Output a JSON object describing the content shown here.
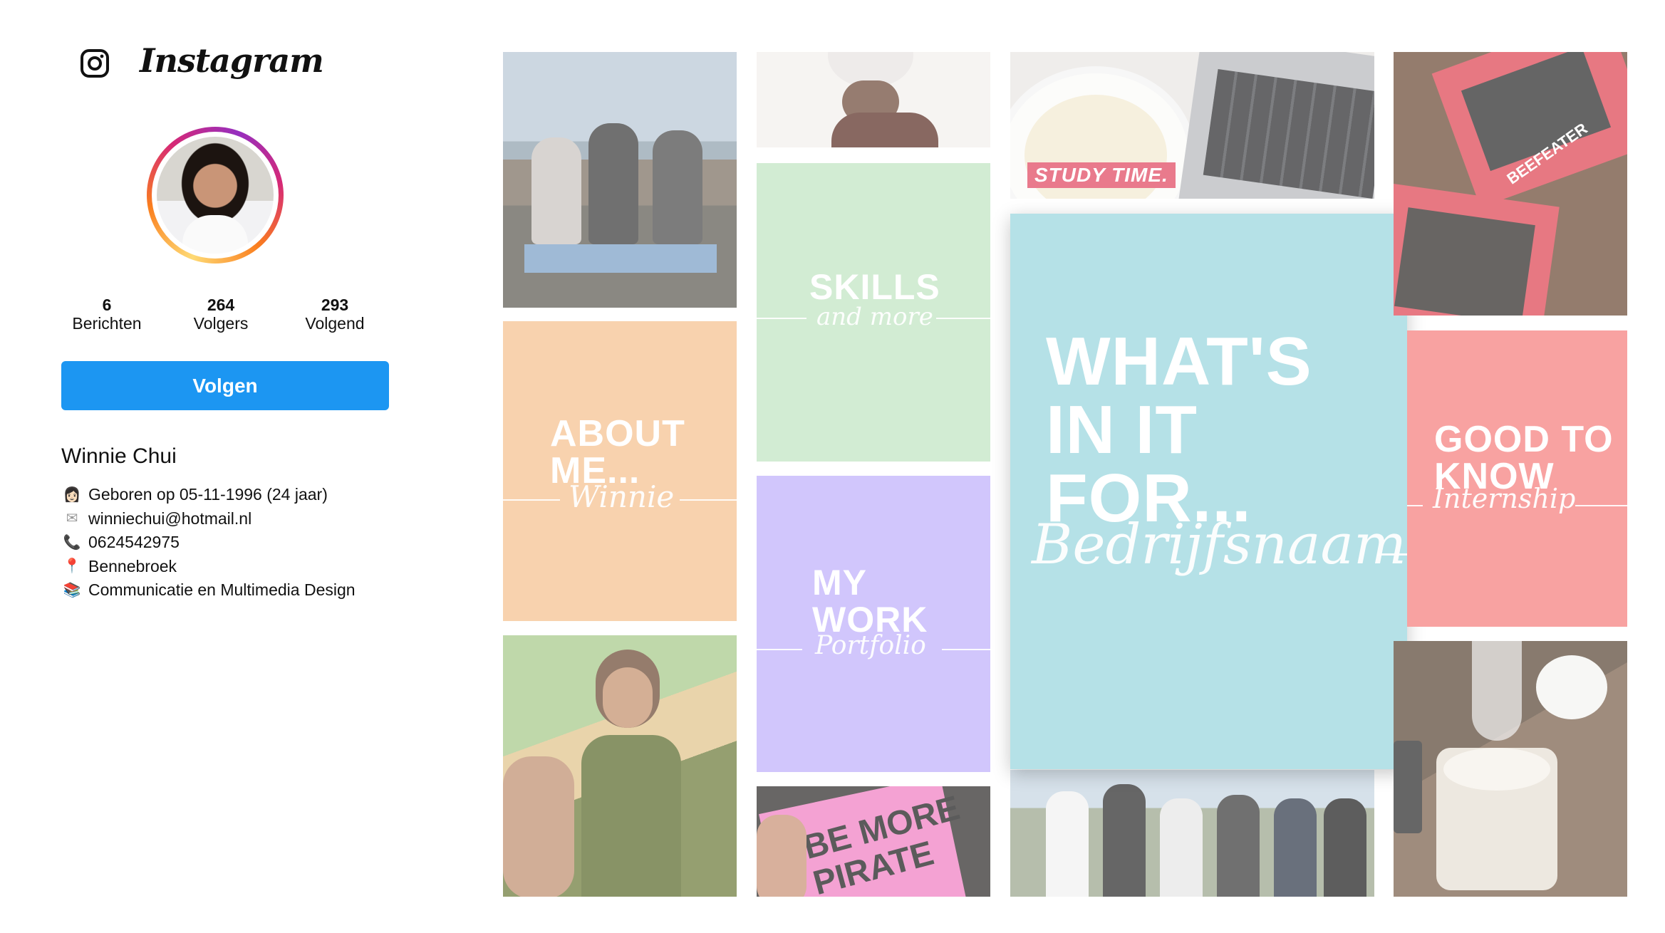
{
  "app": {
    "wordmark": "Instagram",
    "logo_icon": "instagram-camera-icon"
  },
  "profile": {
    "stats": [
      {
        "value": "6",
        "label": "Berichten"
      },
      {
        "value": "264",
        "label": "Volgers"
      },
      {
        "value": "293",
        "label": "Volgend"
      }
    ],
    "follow_label": "Volgen",
    "name": "Winnie Chui",
    "bio": [
      {
        "icon": "woman-emoji-icon",
        "glyph": "👩🏻",
        "text": "Geboren op 05-11-1996 (24 jaar)"
      },
      {
        "icon": "envelope-icon",
        "glyph": "✉",
        "text": "winniechui@hotmail.nl"
      },
      {
        "icon": "phone-icon",
        "glyph": "📞",
        "text": "0624542975"
      },
      {
        "icon": "location-pin-icon",
        "glyph": "📍",
        "text": "Bennebroek"
      },
      {
        "icon": "books-icon",
        "glyph": "📚",
        "text": "Communicatie en Multimedia Design"
      }
    ]
  },
  "tiles": {
    "about": {
      "line1": "ABOUT",
      "line2": "ME...",
      "script": "Winnie"
    },
    "skills": {
      "line1": "SKILLS",
      "script": "and more"
    },
    "work": {
      "line1": "MY",
      "line2": "WORK",
      "script": "Portfolio"
    },
    "whats": {
      "line1": "WHAT'S",
      "line2": "IN IT",
      "line3": "FOR...",
      "script": "Bedrijfsnaam"
    },
    "good": {
      "line1": "GOOD TO",
      "line2": "KNOW",
      "script": "Internship"
    },
    "study_label": "STUDY TIME.",
    "beefeater_label": "BEEFEATER",
    "pirate_label": "BE MORE PIRATE"
  },
  "colors": {
    "follow_button": "#1c96f2",
    "about_tile": "#f8d2ae",
    "skills_tile": "#d2ecd3",
    "work_tile": "#d1c6fc",
    "whats_tile": "#b5e1e7",
    "good_tile": "#f8a2a1"
  }
}
